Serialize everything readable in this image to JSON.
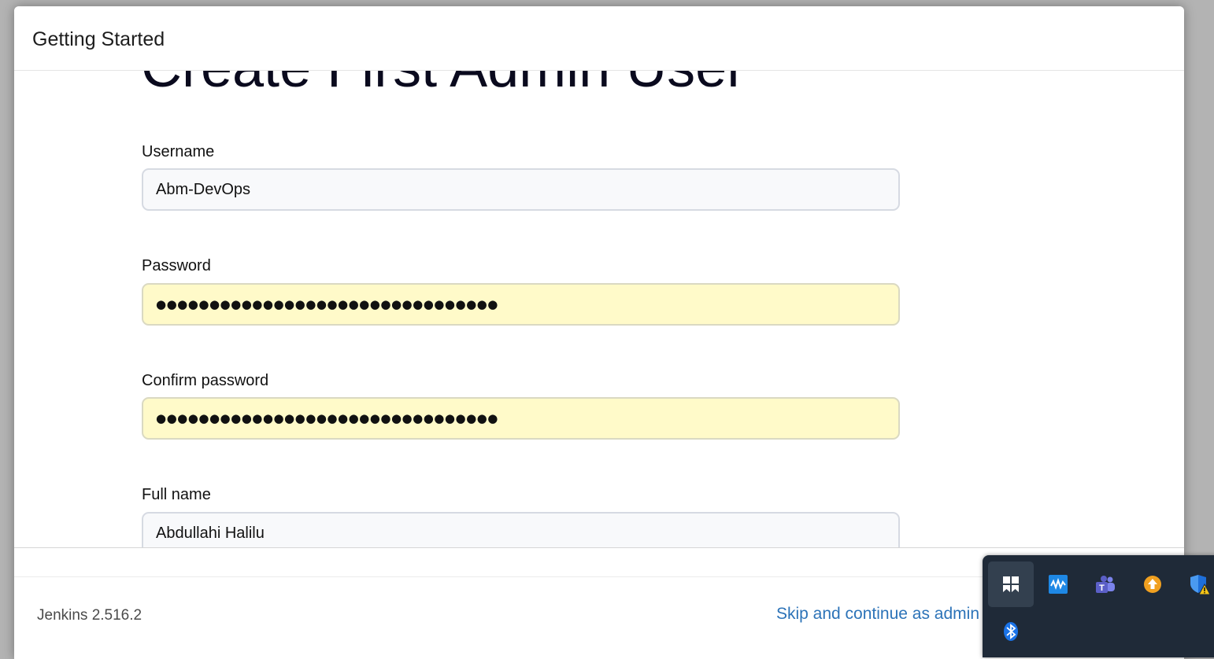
{
  "dialog": {
    "title": "Getting Started"
  },
  "form": {
    "heading": "Create First Admin User",
    "username": {
      "label": "Username",
      "value": "Abm-DevOps"
    },
    "password": {
      "label": "Password",
      "value": "●●●●●●●●●●●●●●●●●●●●●●●●●●●●●●●●"
    },
    "confirm_password": {
      "label": "Confirm password",
      "value": "●●●●●●●●●●●●●●●●●●●●●●●●●●●●●●●●"
    },
    "full_name": {
      "label": "Full name",
      "value": "Abdullahi Halilu"
    }
  },
  "footer": {
    "version": "Jenkins 2.516.2",
    "skip_link": "Skip and continue as admin"
  },
  "tray": {
    "icons": [
      "windows-snap-icon",
      "waveform-app-icon",
      "teams-icon",
      "update-arrow-icon",
      "defender-warning-icon",
      "bluetooth-icon"
    ],
    "colors": {
      "background": "#1f2a38",
      "teams": "#5b5fc7",
      "update": "#f0a020",
      "defender": "#1e6fd9",
      "bluetooth": "#1a73e8"
    }
  }
}
